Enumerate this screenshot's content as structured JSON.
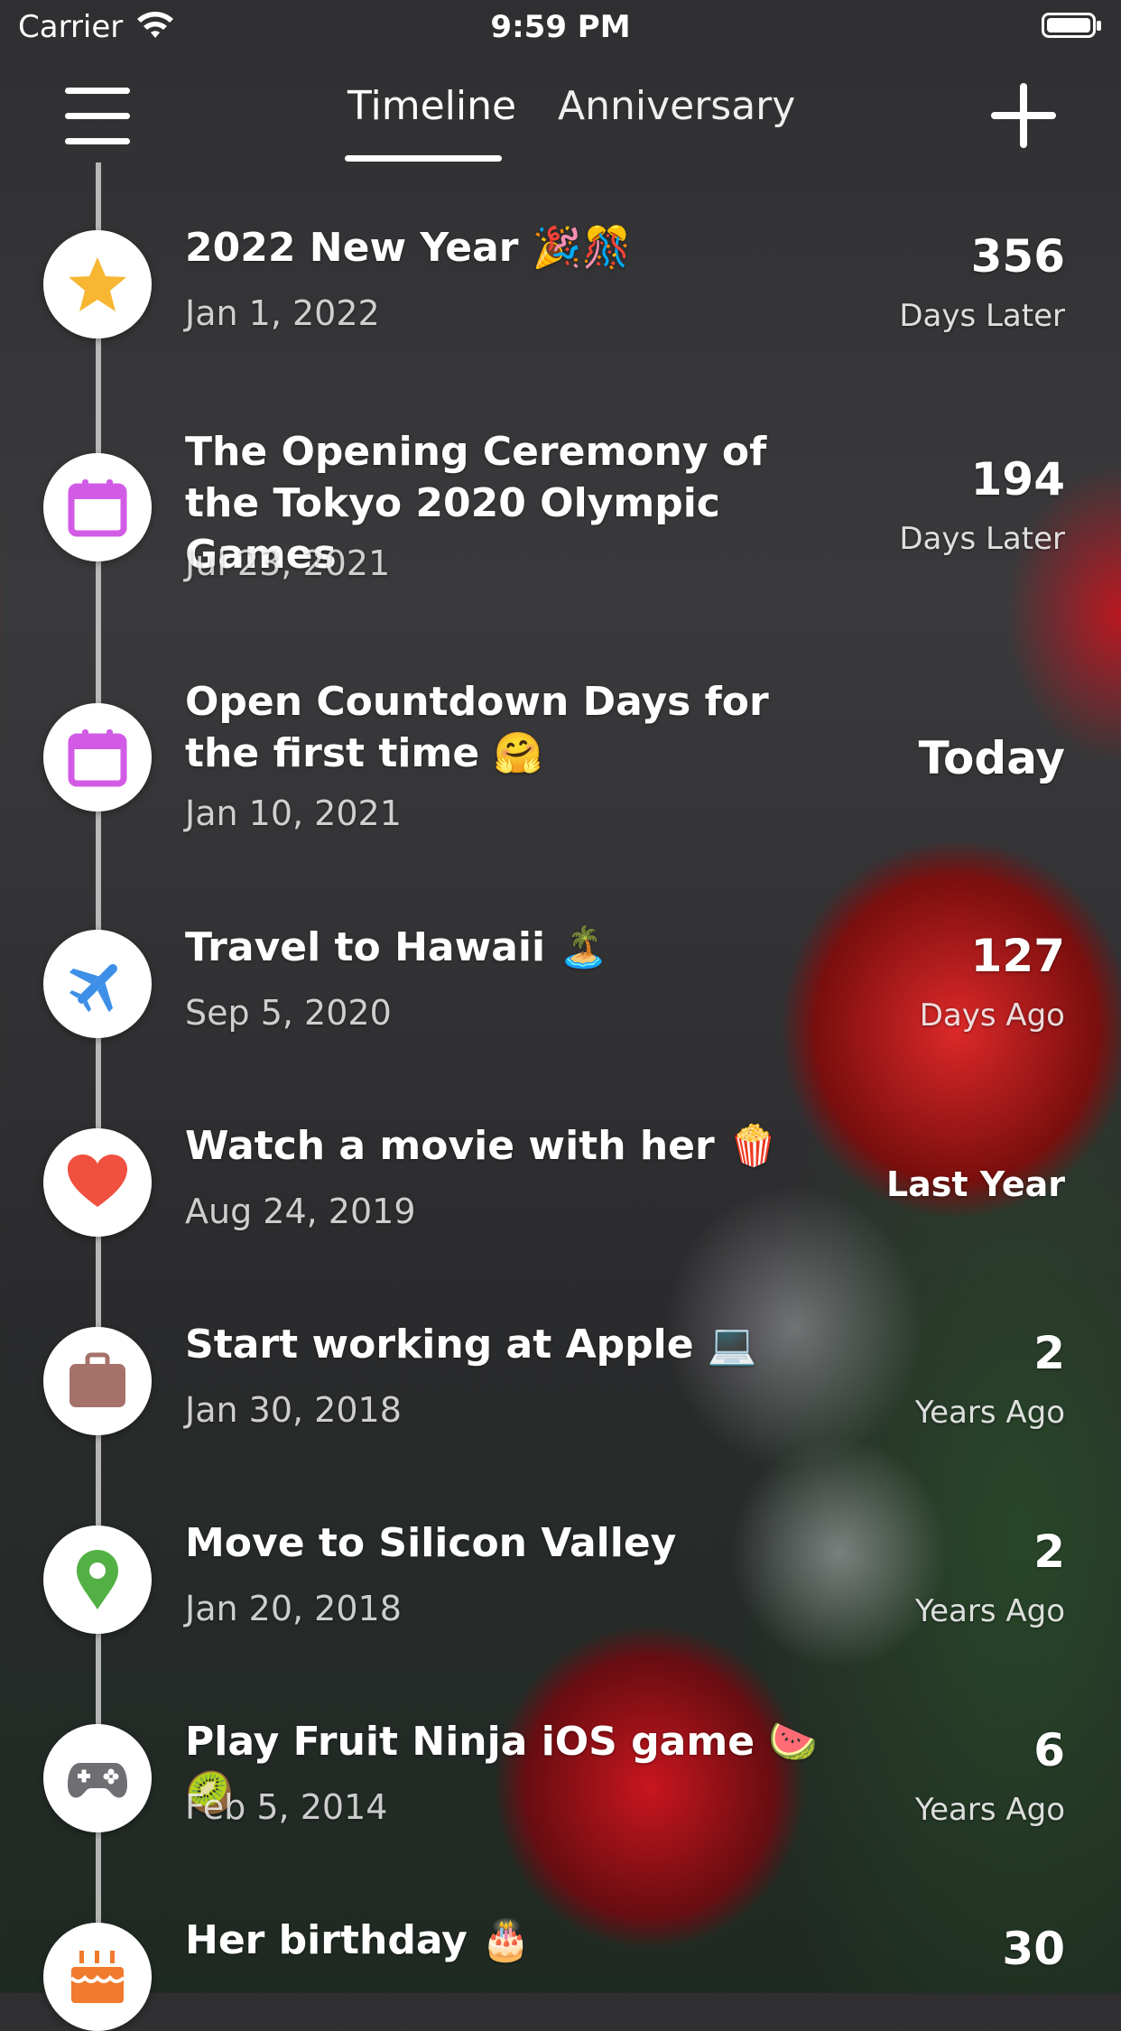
{
  "status_bar": {
    "carrier": "Carrier",
    "time": "9:59 PM"
  },
  "nav": {
    "tabs": [
      {
        "label": "Timeline",
        "active": true
      },
      {
        "label": "Anniversary",
        "active": false
      }
    ],
    "menu_icon": "hamburger-menu-icon",
    "add_icon": "plus-icon"
  },
  "events": [
    {
      "title": "2022 New Year 🎉🎊",
      "date": "Jan 1, 2022",
      "count": "356",
      "unit": "Days Later",
      "icon": "star-icon",
      "icon_color": "#F7B733"
    },
    {
      "title": "The Opening Ceremony of the Tokyo 2020 Olympic Games",
      "date": "Jul 23, 2021",
      "count": "194",
      "unit": "Days Later",
      "icon": "calendar-icon",
      "icon_color": "#D25BE6"
    },
    {
      "title": "Open Countdown Days for the first time 🤗",
      "date": "Jan 10, 2021",
      "count": "Today",
      "unit": "",
      "icon": "calendar-icon",
      "icon_color": "#D25BE6"
    },
    {
      "title": "Travel to Hawaii 🏝️",
      "date": "Sep 5, 2020",
      "count": "127",
      "unit": "Days Ago",
      "icon": "airplane-icon",
      "icon_color": "#3D8FE8"
    },
    {
      "title": "Watch a movie with her 🍿",
      "date": "Aug 24, 2019",
      "count": "Last Year",
      "unit": "",
      "icon": "heart-icon",
      "icon_color": "#F0503F"
    },
    {
      "title": "Start working at Apple 💻",
      "date": "Jan 30, 2018",
      "count": "2",
      "unit": "Years Ago",
      "icon": "briefcase-icon",
      "icon_color": "#A5726A"
    },
    {
      "title": "Move to Silicon Valley",
      "date": "Jan 20, 2018",
      "count": "2",
      "unit": "Years Ago",
      "icon": "location-pin-icon",
      "icon_color": "#53B045"
    },
    {
      "title": "Play Fruit Ninja iOS game 🍉🥝",
      "date": "Feb 5, 2014",
      "count": "6",
      "unit": "Years Ago",
      "icon": "gamepad-icon",
      "icon_color": "#6E6E73"
    },
    {
      "title": "Her birthday 🎂",
      "date": "",
      "count": "30",
      "unit": "",
      "icon": "birthday-cake-icon",
      "icon_color": "#F07A2D"
    }
  ]
}
